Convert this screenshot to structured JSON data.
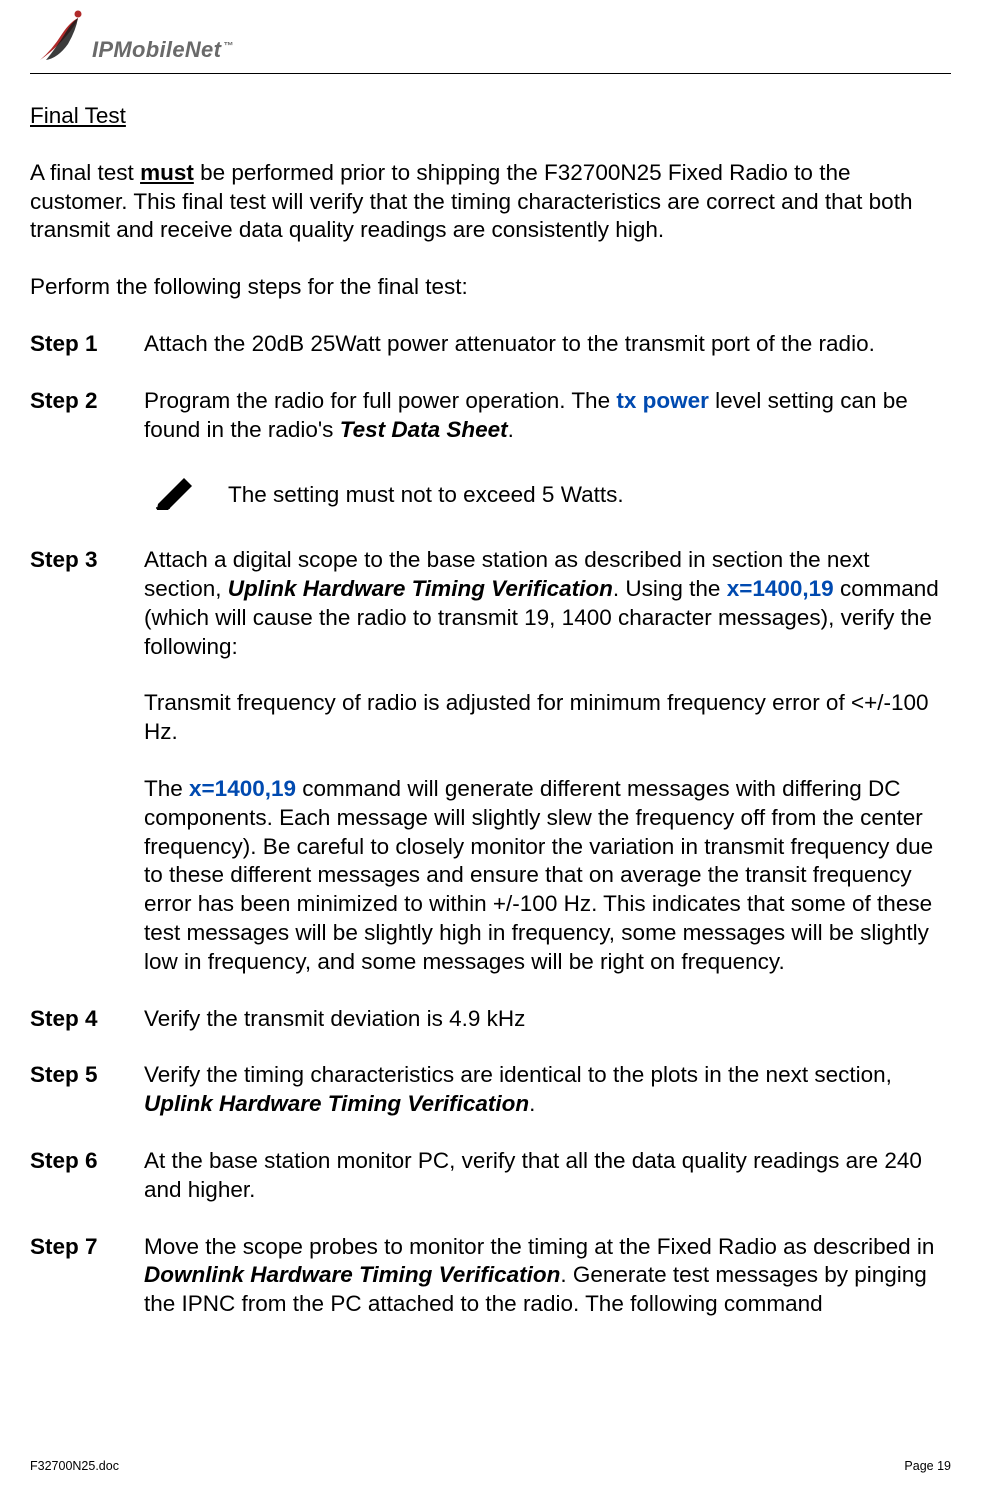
{
  "logo": {
    "brand_text": "IPMobileNet",
    "trademark": "™"
  },
  "section_heading": "Final Test",
  "intro": {
    "p1_a": "A final test ",
    "p1_must": "must",
    "p1_b": " be performed prior to shipping the F32700N25 Fixed Radio to the customer.  This final test will verify that the timing characteristics are correct and that both transmit and receive data quality readings are consistently high.",
    "p2": "Perform the following steps for the final test:"
  },
  "steps": {
    "s1": {
      "label": "Step 1",
      "text": "Attach the 20dB 25Watt power attenuator to the transmit port of the radio."
    },
    "s2": {
      "label": "Step 2",
      "a": "Program the radio for full power operation.  The ",
      "txpower": "tx power",
      "b": " level setting can be found in the radio's ",
      "tds": "Test Data Sheet",
      "c": ".",
      "note": "The setting must not to exceed 5 Watts."
    },
    "s3": {
      "label": "Step 3",
      "p1a": "Attach a digital scope to the base station as described in section the next section, ",
      "p1_ref": "Uplink Hardware Timing Verification",
      "p1b": ".  Using the ",
      "p1_cmd": "x=1400,19",
      "p1c": " command (which will cause the radio to transmit 19, 1400 character messages), verify the following:",
      "p2": "Transmit frequency of radio is adjusted for minimum frequency error of <+/-100 Hz.",
      "p3a": "The ",
      "p3_cmd": "x=1400,19",
      "p3b": " command will generate different messages with differing DC components.  Each message will slightly slew the frequency off from the center frequency). Be careful to closely monitor the variation in transmit frequency due to these different messages and ensure that on average the transit frequency error has been minimized to within +/-100 Hz. This indicates that some of these test messages will be slightly high in frequency, some messages will be slightly low in frequency, and some messages will be right on frequency."
    },
    "s4": {
      "label": "Step 4",
      "text": "Verify the transmit deviation is 4.9 kHz"
    },
    "s5": {
      "label": "Step 5",
      "a": "Verify the timing characteristics are identical to the plots in the next section, ",
      "ref": "Uplink Hardware Timing Verification",
      "b": "."
    },
    "s6": {
      "label": "Step 6",
      "text": "At the base station monitor PC, verify that all the data quality readings are 240 and higher."
    },
    "s7": {
      "label": "Step 7",
      "a": "Move the scope probes to monitor the timing at the Fixed Radio as described in ",
      "ref": "Downlink Hardware Timing Verification",
      "b": ". Generate test messages by pinging the IPNC from the PC attached to the radio.  The following command"
    }
  },
  "footer": {
    "doc": "F32700N25.doc",
    "page": "Page 19"
  }
}
